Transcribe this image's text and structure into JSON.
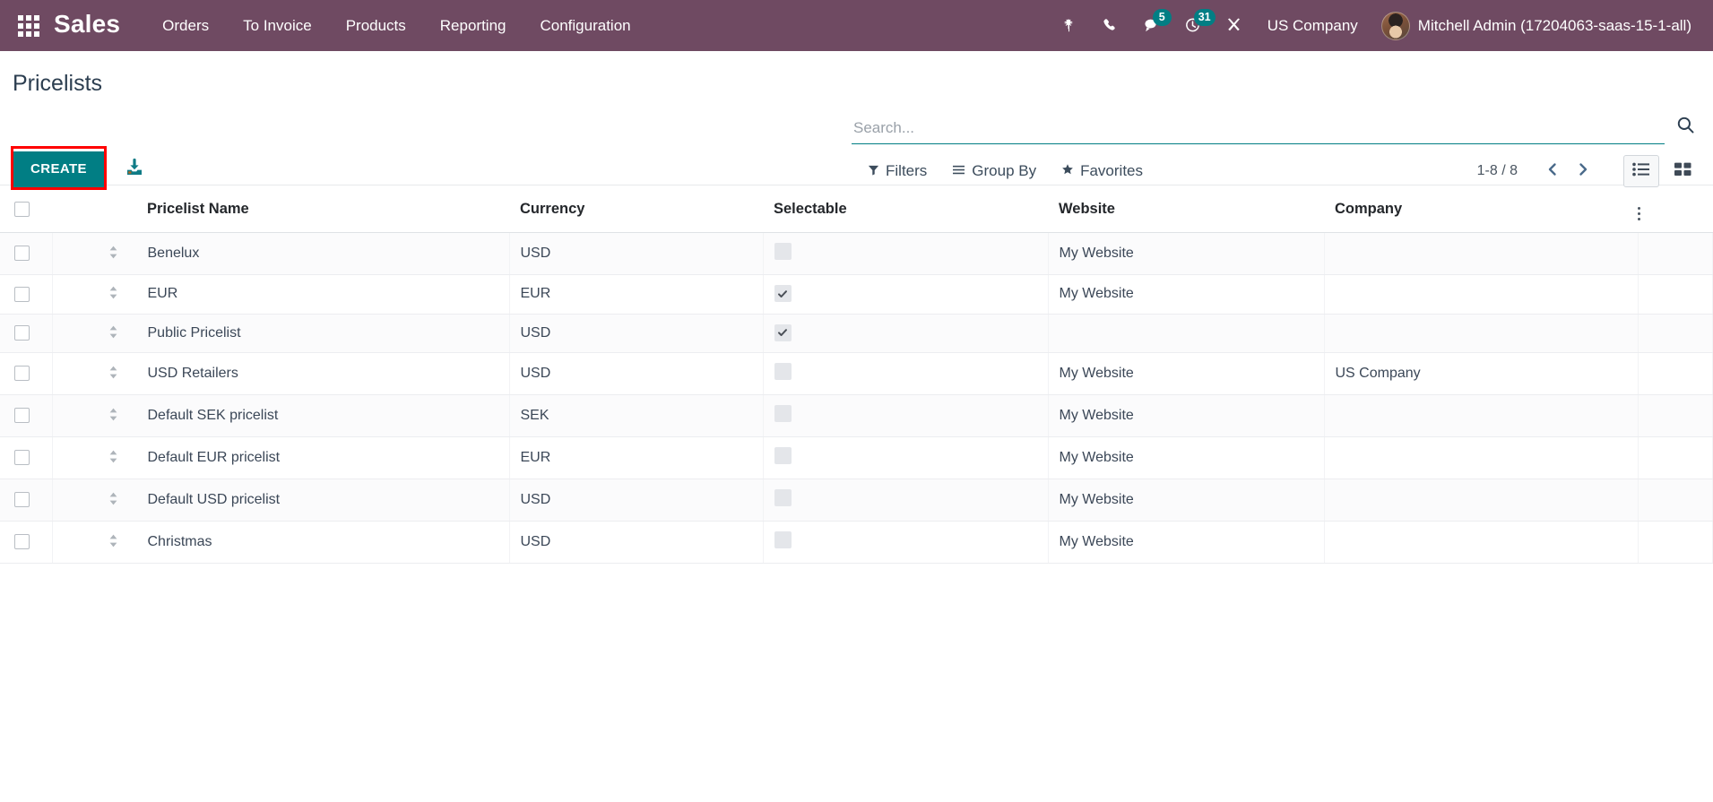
{
  "navbar": {
    "apps_icon": "apps-grid-icon",
    "brand": "Sales",
    "menu": [
      {
        "label": "Orders"
      },
      {
        "label": "To Invoice"
      },
      {
        "label": "Products"
      },
      {
        "label": "Reporting"
      },
      {
        "label": "Configuration"
      }
    ],
    "sys_icons": [
      {
        "name": "bug-icon",
        "badge": null
      },
      {
        "name": "phone-icon",
        "badge": null
      },
      {
        "name": "chat-icon",
        "badge": "5"
      },
      {
        "name": "activity-clock-icon",
        "badge": "31"
      },
      {
        "name": "tools-icon",
        "badge": null
      }
    ],
    "company": "US Company",
    "user_name": "Mitchell Admin (17204063-saas-15-1-all)",
    "bg_color": "#6f4a62",
    "badge_color": "#017e84"
  },
  "control_panel": {
    "breadcrumb": "Pricelists",
    "create_label": "CREATE",
    "create_color": "#017e84",
    "highlight_color": "#ff0000",
    "import_icon": "import-download-icon",
    "search": {
      "placeholder": "Search...",
      "value": "",
      "icon": "search-icon"
    },
    "filters": [
      {
        "label": "Filters",
        "icon": "filter-funnel-icon"
      },
      {
        "label": "Group By",
        "icon": "group-by-lines-icon"
      },
      {
        "label": "Favorites",
        "icon": "star-icon"
      }
    ],
    "pager": {
      "count": "1-8 / 8",
      "prev_icon": "chevron-left-icon",
      "next_icon": "chevron-right-icon"
    },
    "views": [
      {
        "name": "list-view",
        "icon": "list-icon",
        "active": true
      },
      {
        "name": "kanban-view",
        "icon": "kanban-grid-icon",
        "active": false
      }
    ]
  },
  "table": {
    "columns": [
      {
        "key": "name",
        "label": "Pricelist Name"
      },
      {
        "key": "currency",
        "label": "Currency"
      },
      {
        "key": "selectable",
        "label": "Selectable"
      },
      {
        "key": "website",
        "label": "Website"
      },
      {
        "key": "company",
        "label": "Company"
      }
    ],
    "options_icon": "vertical-dots-icon",
    "rows": [
      {
        "name": "Benelux",
        "currency": "USD",
        "selectable": false,
        "website": "My Website",
        "company": ""
      },
      {
        "name": "EUR",
        "currency": "EUR",
        "selectable": true,
        "website": "My Website",
        "company": ""
      },
      {
        "name": "Public Pricelist",
        "currency": "USD",
        "selectable": true,
        "website": "",
        "company": ""
      },
      {
        "name": "USD Retailers",
        "currency": "USD",
        "selectable": false,
        "website": "My Website",
        "company": "US Company"
      },
      {
        "name": "Default SEK pricelist",
        "currency": "SEK",
        "selectable": false,
        "website": "My Website",
        "company": ""
      },
      {
        "name": "Default EUR pricelist",
        "currency": "EUR",
        "selectable": false,
        "website": "My Website",
        "company": ""
      },
      {
        "name": "Default USD pricelist",
        "currency": "USD",
        "selectable": false,
        "website": "My Website",
        "company": ""
      },
      {
        "name": "Christmas",
        "currency": "USD",
        "selectable": false,
        "website": "My Website",
        "company": ""
      }
    ]
  }
}
